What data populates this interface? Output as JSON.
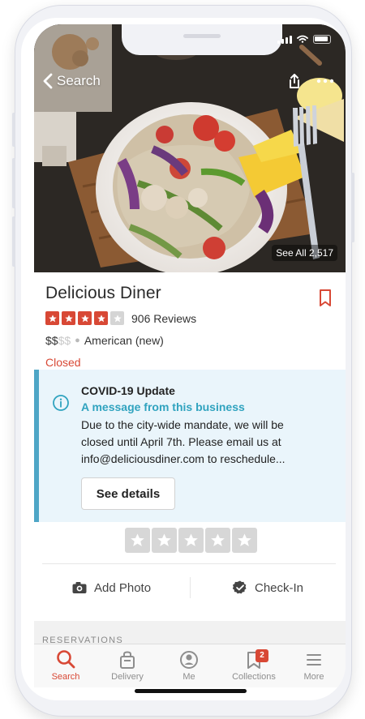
{
  "header": {
    "back_label": "Search",
    "see_all_label": "See All 2,517"
  },
  "business": {
    "name": "Delicious Diner",
    "rating": 4,
    "rating_max": 5,
    "review_count": "906 Reviews",
    "price_filled": "$$",
    "price_empty": "$$",
    "category": "American (new)",
    "status": "Closed"
  },
  "covid": {
    "title": "COVID-19 Update",
    "subtitle": "A message from this business",
    "body": "Due to the city-wide mandate, we will be closed until April 7th. Please email us at info@deliciousdiner.com to reschedule...",
    "button_label": "See details"
  },
  "actions": {
    "add_photo_label": "Add Photo",
    "check_in_label": "Check-In"
  },
  "sections": {
    "reservations_label": "RESERVATIONS"
  },
  "tabs": {
    "items": [
      {
        "label": "Search",
        "icon": "search-icon",
        "active": true
      },
      {
        "label": "Delivery",
        "icon": "delivery-icon",
        "active": false
      },
      {
        "label": "Me",
        "icon": "me-icon",
        "active": false
      },
      {
        "label": "Collections",
        "icon": "collections-icon",
        "active": false,
        "badge": "2"
      },
      {
        "label": "More",
        "icon": "menu-icon",
        "active": false
      }
    ]
  },
  "colors": {
    "brand_red": "#d84835",
    "covid_accent": "#30a3bf",
    "covid_bg": "#eaf5fb"
  }
}
